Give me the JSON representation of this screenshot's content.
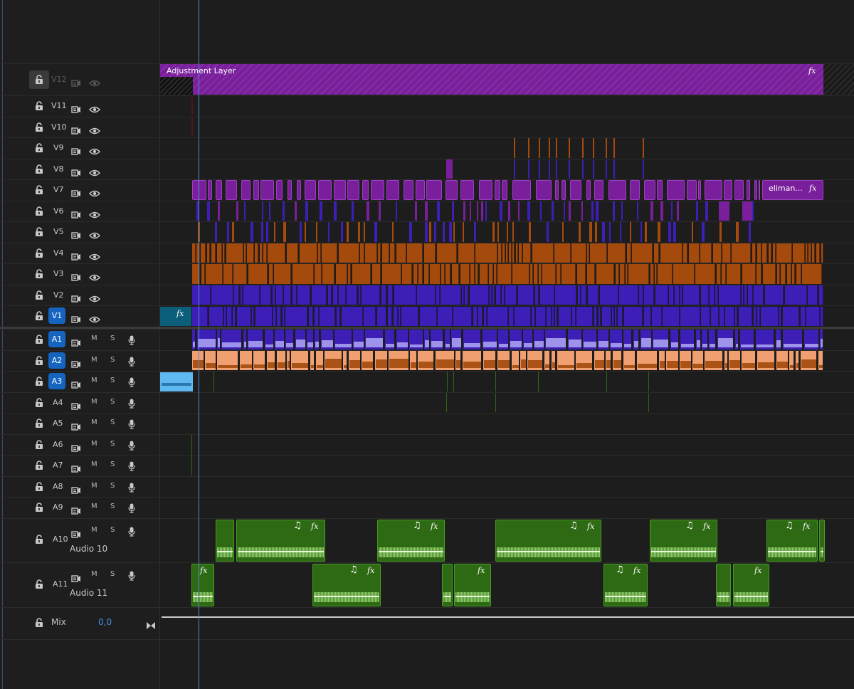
{
  "tracks_video": [
    {
      "name": "V12",
      "targeted": false,
      "locked": true
    },
    {
      "name": "V11",
      "targeted": false
    },
    {
      "name": "V10",
      "targeted": false
    },
    {
      "name": "V9",
      "targeted": false
    },
    {
      "name": "V8",
      "targeted": false
    },
    {
      "name": "V7",
      "targeted": false
    },
    {
      "name": "V6",
      "targeted": false
    },
    {
      "name": "V5",
      "targeted": false
    },
    {
      "name": "V4",
      "targeted": false
    },
    {
      "name": "V3",
      "targeted": false
    },
    {
      "name": "V2",
      "targeted": false
    },
    {
      "name": "V1",
      "targeted": true
    }
  ],
  "tracks_audio": [
    {
      "name": "A1",
      "targeted": true,
      "m": "M",
      "s": "S"
    },
    {
      "name": "A2",
      "targeted": true,
      "m": "M",
      "s": "S"
    },
    {
      "name": "A3",
      "targeted": true,
      "m": "M",
      "s": "S"
    },
    {
      "name": "A4",
      "targeted": false,
      "m": "M",
      "s": "S"
    },
    {
      "name": "A5",
      "targeted": false,
      "m": "M",
      "s": "S"
    },
    {
      "name": "A6",
      "targeted": false,
      "m": "M",
      "s": "S"
    },
    {
      "name": "A7",
      "targeted": false,
      "m": "M",
      "s": "S"
    },
    {
      "name": "A8",
      "targeted": false,
      "m": "M",
      "s": "S"
    },
    {
      "name": "A9",
      "targeted": false,
      "m": "M",
      "s": "S"
    },
    {
      "name": "A10",
      "targeted": false,
      "m": "M",
      "s": "S",
      "subname": "Audio 10"
    },
    {
      "name": "A11",
      "targeted": false,
      "m": "M",
      "s": "S",
      "subname": "Audio 11"
    }
  ],
  "mix": {
    "label": "Mix",
    "value": "0,0"
  },
  "clips": {
    "adjustment_label": "Adjustment Layer",
    "fx": "fx",
    "v7_label": "eliman...",
    "note": "♫"
  },
  "colors": {
    "purple": "#7a1f9c",
    "violet": "#3d1fb8",
    "orange": "#a34a0c",
    "peach": "#f0a070",
    "teal": "#0b5f7a",
    "green": "#2e6a14",
    "lightblue": "#5fb8f0",
    "target_blue": "#1565c0"
  }
}
